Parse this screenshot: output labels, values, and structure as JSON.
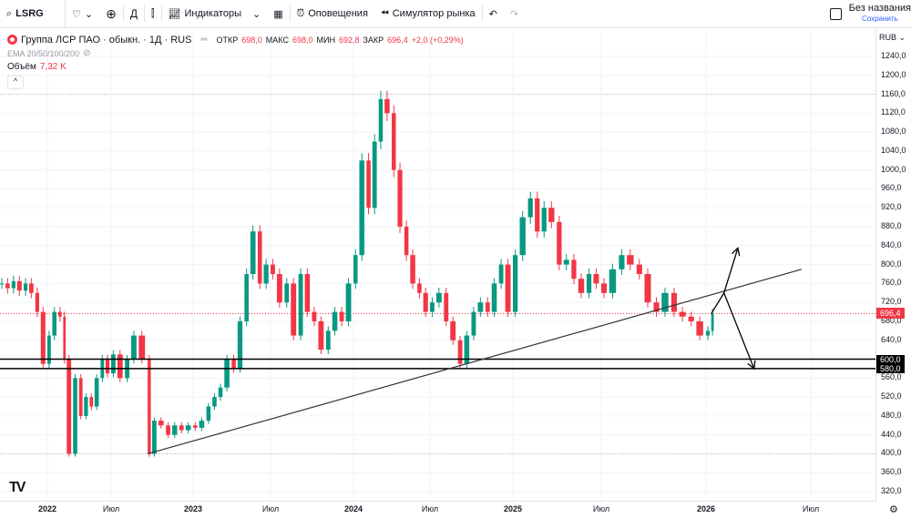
{
  "toolbar": {
    "symbol": "LSRG",
    "interval": "Д",
    "indicators": "Индикаторы",
    "alerts": "Оповещения",
    "replay": "Симулятор рынка",
    "layout_name": "Без названия",
    "save": "Сохранить"
  },
  "legend": {
    "title": "Группа ЛСР ПАО · обыкн. · 1Д · RUS",
    "o_label": "ОТКР",
    "o": "698,0",
    "h_label": "МАКС",
    "h": "698,0",
    "l_label": "МИН",
    "l": "692,8",
    "c_label": "ЗАКР",
    "c": "696,4",
    "change": "+2,0 (+0,29%)",
    "ema": "EMA 20/50/100/200",
    "volume_label": "Объём",
    "volume": "7,32 K"
  },
  "currency": "RUB",
  "colors": {
    "up": "#089981",
    "down": "#f23645",
    "brand": "#f23645"
  },
  "chart_data": {
    "type": "candlestick",
    "ylim": [
      300,
      1260
    ],
    "yticks": [
      "1240,0",
      "1200,0",
      "1160,0",
      "1120,0",
      "1080,0",
      "1040,0",
      "1000,0",
      "960,0",
      "920,0",
      "880,0",
      "840,0",
      "800,0",
      "760,0",
      "720,0",
      "680,0",
      "640,0",
      "600,0",
      "560,0",
      "520,0",
      "480,0",
      "440,0",
      "400,0",
      "360,0",
      "320,0"
    ],
    "xticks": [
      {
        "label": "2022",
        "date": "2022-01-01"
      },
      {
        "label": "Июл",
        "date": "2022-07-01"
      },
      {
        "label": "2023",
        "date": "2023-01-01"
      },
      {
        "label": "Июл",
        "date": "2023-07-01"
      },
      {
        "label": "2024",
        "date": "2024-01-01"
      },
      {
        "label": "Июл",
        "date": "2024-07-01"
      },
      {
        "label": "2025",
        "date": "2025-01-01"
      },
      {
        "label": "Июл",
        "date": "2025-07-01"
      },
      {
        "label": "2026",
        "date": "2026-01-01"
      },
      {
        "label": "Июл",
        "date": "2026-07-01"
      }
    ],
    "last_price": "696,4",
    "levels": [
      {
        "value": 600,
        "label": "600,0"
      },
      {
        "value": 580,
        "label": "580,0"
      }
    ],
    "dotted_levels": [
      1160,
      400
    ],
    "trendline": [
      {
        "date": "2022-09-21",
        "price": 400
      },
      {
        "date": "2026-06-15",
        "price": 790
      }
    ],
    "arrows": [
      {
        "from": {
          "date": "2026-01-10",
          "price": 696
        },
        "via": {
          "date": "2026-02-01",
          "price": 740
        },
        "to": {
          "date": "2026-02-25",
          "price": 835
        }
      },
      {
        "from": {
          "date": "2026-02-01",
          "price": 740
        },
        "to": {
          "date": "2026-03-25",
          "price": 580
        }
      }
    ],
    "close": [
      [
        "2021-09-01",
        760
      ],
      [
        "2021-09-15",
        750
      ],
      [
        "2021-10-01",
        765
      ],
      [
        "2021-10-15",
        745
      ],
      [
        "2021-11-01",
        760
      ],
      [
        "2021-11-15",
        740
      ],
      [
        "2021-12-01",
        700
      ],
      [
        "2021-12-15",
        590
      ],
      [
        "2022-01-01",
        650
      ],
      [
        "2022-01-15",
        700
      ],
      [
        "2022-02-01",
        690
      ],
      [
        "2022-02-15",
        600
      ],
      [
        "2022-02-25",
        400
      ],
      [
        "2022-03-15",
        560
      ],
      [
        "2022-04-01",
        480
      ],
      [
        "2022-04-15",
        520
      ],
      [
        "2022-05-01",
        500
      ],
      [
        "2022-05-15",
        560
      ],
      [
        "2022-06-01",
        600
      ],
      [
        "2022-06-15",
        570
      ],
      [
        "2022-07-01",
        610
      ],
      [
        "2022-07-15",
        560
      ],
      [
        "2022-08-01",
        600
      ],
      [
        "2022-08-15",
        650
      ],
      [
        "2022-09-01",
        600
      ],
      [
        "2022-09-21",
        400
      ],
      [
        "2022-10-01",
        470
      ],
      [
        "2022-10-15",
        460
      ],
      [
        "2022-11-01",
        440
      ],
      [
        "2022-11-15",
        460
      ],
      [
        "2022-12-01",
        450
      ],
      [
        "2022-12-15",
        460
      ],
      [
        "2023-01-01",
        455
      ],
      [
        "2023-01-15",
        470
      ],
      [
        "2023-02-01",
        500
      ],
      [
        "2023-02-15",
        520
      ],
      [
        "2023-03-01",
        540
      ],
      [
        "2023-03-15",
        600
      ],
      [
        "2023-04-01",
        580
      ],
      [
        "2023-04-15",
        680
      ],
      [
        "2023-05-01",
        780
      ],
      [
        "2023-05-15",
        870
      ],
      [
        "2023-06-01",
        760
      ],
      [
        "2023-06-15",
        800
      ],
      [
        "2023-07-01",
        780
      ],
      [
        "2023-07-15",
        720
      ],
      [
        "2023-08-01",
        760
      ],
      [
        "2023-08-15",
        650
      ],
      [
        "2023-09-01",
        780
      ],
      [
        "2023-09-15",
        700
      ],
      [
        "2023-10-01",
        680
      ],
      [
        "2023-10-15",
        620
      ],
      [
        "2023-11-01",
        660
      ],
      [
        "2023-11-15",
        700
      ],
      [
        "2023-12-01",
        680
      ],
      [
        "2023-12-15",
        760
      ],
      [
        "2024-01-01",
        820
      ],
      [
        "2024-01-15",
        1020
      ],
      [
        "2024-02-01",
        920
      ],
      [
        "2024-02-15",
        1060
      ],
      [
        "2024-03-01",
        1150
      ],
      [
        "2024-03-15",
        1120
      ],
      [
        "2024-04-01",
        1000
      ],
      [
        "2024-04-15",
        880
      ],
      [
        "2024-05-01",
        820
      ],
      [
        "2024-05-15",
        760
      ],
      [
        "2024-06-01",
        740
      ],
      [
        "2024-06-15",
        700
      ],
      [
        "2024-07-01",
        720
      ],
      [
        "2024-07-15",
        740
      ],
      [
        "2024-08-01",
        680
      ],
      [
        "2024-08-15",
        640
      ],
      [
        "2024-09-01",
        590
      ],
      [
        "2024-09-15",
        650
      ],
      [
        "2024-10-01",
        700
      ],
      [
        "2024-10-15",
        720
      ],
      [
        "2024-11-01",
        700
      ],
      [
        "2024-11-15",
        760
      ],
      [
        "2024-12-01",
        800
      ],
      [
        "2024-12-15",
        700
      ],
      [
        "2025-01-01",
        820
      ],
      [
        "2025-01-15",
        900
      ],
      [
        "2025-02-01",
        940
      ],
      [
        "2025-02-15",
        870
      ],
      [
        "2025-03-01",
        920
      ],
      [
        "2025-03-15",
        890
      ],
      [
        "2025-04-01",
        800
      ],
      [
        "2025-04-15",
        810
      ],
      [
        "2025-05-01",
        770
      ],
      [
        "2025-05-15",
        740
      ],
      [
        "2025-06-01",
        780
      ],
      [
        "2025-06-15",
        760
      ],
      [
        "2025-07-01",
        740
      ],
      [
        "2025-07-15",
        790
      ],
      [
        "2025-08-01",
        820
      ],
      [
        "2025-08-15",
        800
      ],
      [
        "2025-09-01",
        780
      ],
      [
        "2025-09-15",
        720
      ],
      [
        "2025-10-01",
        700
      ],
      [
        "2025-10-15",
        740
      ],
      [
        "2025-11-01",
        700
      ],
      [
        "2025-11-15",
        690
      ],
      [
        "2025-12-01",
        680
      ],
      [
        "2025-12-15",
        650
      ],
      [
        "2026-01-01",
        660
      ],
      [
        "2026-01-10",
        696.4
      ]
    ]
  }
}
